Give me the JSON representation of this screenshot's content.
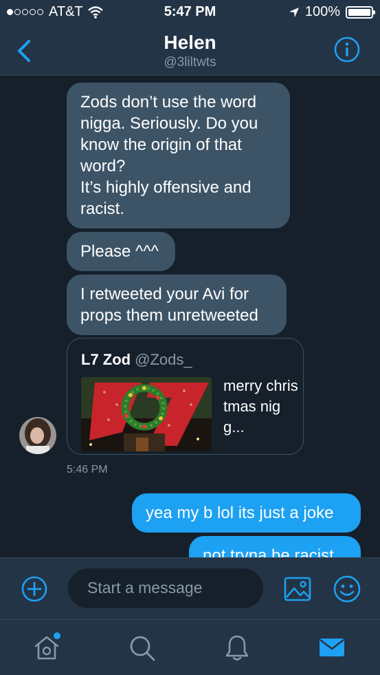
{
  "status_bar": {
    "carrier": "AT&T",
    "time": "5:47 PM",
    "battery": "100%",
    "signal_bars_filled": 1,
    "signal_bars_total": 5,
    "icons": [
      "signal-dots-icon",
      "wifi-icon",
      "location-arrow-icon",
      "battery-icon"
    ]
  },
  "header": {
    "name": "Helen",
    "handle": "@3liltwts",
    "icons": [
      "back-chevron-icon",
      "info-icon"
    ]
  },
  "messages": [
    {
      "direction": "incoming",
      "text": "Zods don’t use the word\nnigga. Seriously. Do you\nknow the origin of that\nword?\nIt’s highly offensive and\nracist."
    },
    {
      "direction": "incoming",
      "text": "Please ^^^"
    },
    {
      "direction": "incoming",
      "text": "I retweeted your Avi for\nprops them unretweeted"
    }
  ],
  "quoted_tweet": {
    "name": "L7 Zod",
    "handle": "@Zods_",
    "text": "merry christmas nigg...",
    "image": "l7-logo-christmas-wreath-image"
  },
  "incoming_timestamp": "5:46 PM",
  "outgoing_messages": [
    {
      "text": "yea my b lol its just a joke"
    },
    {
      "text": "not tryna be racist"
    }
  ],
  "composer": {
    "placeholder": "Start a message",
    "icons": [
      "add-circle-icon",
      "photo-icon",
      "emoji-icon"
    ]
  },
  "tab_bar": {
    "tabs": [
      {
        "name": "home",
        "icon": "home-icon",
        "has_notification_dot": true
      },
      {
        "name": "search",
        "icon": "search-icon"
      },
      {
        "name": "notifications",
        "icon": "bell-icon"
      },
      {
        "name": "messages",
        "icon": "mail-icon",
        "active": true
      }
    ]
  },
  "colors": {
    "background": "#15202b",
    "bar_background": "#243447",
    "incoming_bubble": "#3d5466",
    "outgoing_bubble": "#1da1f2",
    "accent": "#1da1f2",
    "secondary_text": "#8899a6"
  }
}
